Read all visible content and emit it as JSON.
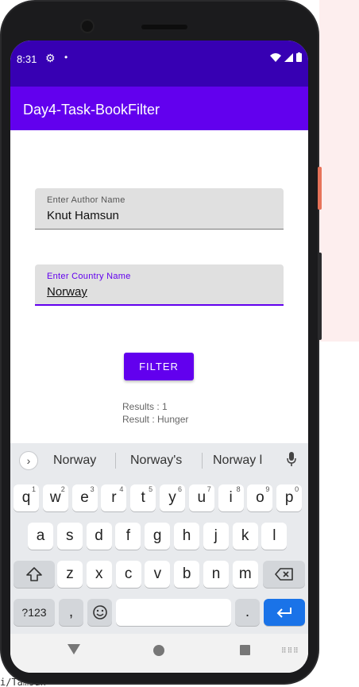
{
  "status_bar": {
    "time": "8:31",
    "gear_icon": "settings-gear",
    "dot": "•"
  },
  "app_bar": {
    "title": "Day4-Task-BookFilter"
  },
  "author_field": {
    "label": "Enter  Author Name",
    "value": "Knut Hamsun"
  },
  "country_field": {
    "label": "Enter  Country Name",
    "value": "Norway"
  },
  "filter_button": {
    "label": "FILTER"
  },
  "results": {
    "count_line": "Results : 1",
    "result_line": "Result : Hunger"
  },
  "keyboard": {
    "suggestions": [
      "Norway",
      "Norway's",
      "Norway l"
    ],
    "row1": [
      {
        "k": "q",
        "n": "1"
      },
      {
        "k": "w",
        "n": "2"
      },
      {
        "k": "e",
        "n": "3"
      },
      {
        "k": "r",
        "n": "4"
      },
      {
        "k": "t",
        "n": "5"
      },
      {
        "k": "y",
        "n": "6"
      },
      {
        "k": "u",
        "n": "7"
      },
      {
        "k": "i",
        "n": "8"
      },
      {
        "k": "o",
        "n": "9"
      },
      {
        "k": "p",
        "n": "0"
      }
    ],
    "row2": [
      "a",
      "s",
      "d",
      "f",
      "g",
      "h",
      "j",
      "k",
      "l"
    ],
    "row3": [
      "z",
      "x",
      "c",
      "v",
      "b",
      "n",
      "m"
    ],
    "symbols_key": "?123",
    "comma_key": ",",
    "period_key": "."
  },
  "bottom_text": "i/Tamsun",
  "colors": {
    "primary": "#6200ee",
    "primary_dark": "#3700b3",
    "enter_key": "#1a73e8"
  }
}
